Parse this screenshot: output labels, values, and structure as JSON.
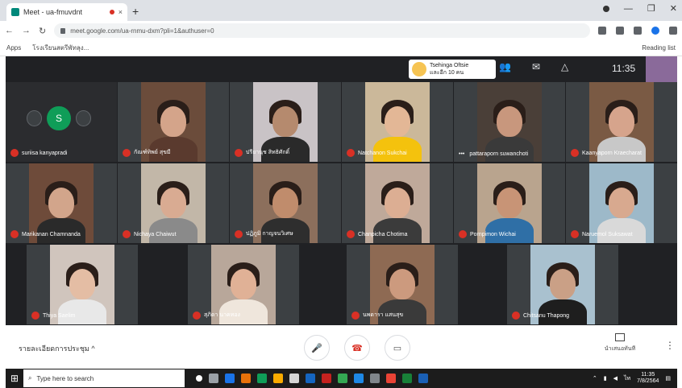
{
  "browser": {
    "tab_title": "Meet - ua-fmuvdnt",
    "tab_close": "×",
    "new_tab": "+",
    "url": "meet.google.com/ua-rnmu-dxm?pli=1&authuser=0",
    "bookmark_apps": "Apps",
    "bookmark_1": "โรงเรียนสตรีพัทลุง...",
    "bookmark_reading": "Reading list"
  },
  "meet": {
    "presenter_name": "Tsehinga Oftsie",
    "presenter_sub": "และอีก 10 คน",
    "clock": "11:35",
    "self_initial": "S",
    "meeting_details": "รายละเอียดการประชุม ^",
    "present_label": "นำเสนอทันที",
    "participants": [
      {
        "name": "suriisa kanyapradi",
        "bg": "#2b2c2f",
        "skin": "#c79a7c",
        "shirt": "#3a3a3a",
        "self": true
      },
      {
        "name": "กัณฑ์ทิพย์ สุขมี",
        "bg": "#6b4c3b",
        "skin": "#d4a48a",
        "shirt": "#5a3a2e"
      },
      {
        "name": "ปรียานุช สิทธิศักดิ์",
        "bg": "#c9c3c6",
        "skin": "#b58a6e",
        "shirt": "#2a2a2a"
      },
      {
        "name": "Natchanon Sukchai",
        "bg": "#cbb89a",
        "skin": "#e3b796",
        "shirt": "#f4c20d"
      },
      {
        "name": "pattaraporn suwanchoti",
        "bg": "#4a3f38",
        "skin": "#c8977d",
        "shirt": "#3a3a3a",
        "more": true
      },
      {
        "name": "Kaanyaporn Kraecharat",
        "bg": "#7a5a44",
        "skin": "#d6a48c",
        "shirt": "#c8c8c8"
      },
      {
        "name": "Marikanan Chamnanda",
        "bg": "#6e4b3a",
        "skin": "#d2a58b",
        "shirt": "#2a2a2a"
      },
      {
        "name": "Nichaya Chaiwut",
        "bg": "#c2b7a8",
        "skin": "#d9ab92",
        "shirt": "#8a8a8a"
      },
      {
        "name": "ปฏิภูมิ กาญจนวิเศษ",
        "bg": "#8c6f5c",
        "skin": "#c08c6c",
        "shirt": "#2e2e2e"
      },
      {
        "name": "Chanpicha Chotima",
        "bg": "#bfa99a",
        "skin": "#dcae93",
        "shirt": "#3b3b3b"
      },
      {
        "name": "Pornpimon Wichai",
        "bg": "#b9a48e",
        "skin": "#c89476",
        "shirt": "#2f6fa6"
      },
      {
        "name": "Naruemol Suksawat",
        "bg": "#9db9c9",
        "skin": "#d8a98f",
        "shirt": "#d9d9d9"
      },
      {
        "name": "Thiya Saelim",
        "bg": "#d0c5bd",
        "skin": "#e4bda4",
        "shirt": "#e8e8e8"
      },
      {
        "name": "สุภิดา นาคทอง",
        "bg": "#b8a79a",
        "skin": "#e0b196",
        "shirt": "#efe6dc"
      },
      {
        "name": "นพดารา แสนสุข",
        "bg": "#8e6a53",
        "skin": "#cc9a7e",
        "shirt": "#3a3a3a"
      },
      {
        "name": "Chitsanu Thapong",
        "bg": "#a9c1cf",
        "skin": "#caa086",
        "shirt": "#1e1e1e"
      }
    ]
  },
  "taskbar": {
    "search_placeholder": "Type here to search",
    "time": "11:35",
    "date": "7/8/2564"
  },
  "colors": {
    "meet_bg": "#202124",
    "tile_bg": "#3c4043",
    "mic_off": "#d93025",
    "self_avatar": "#0f9d58",
    "taskbar": "#1c1c1c"
  }
}
